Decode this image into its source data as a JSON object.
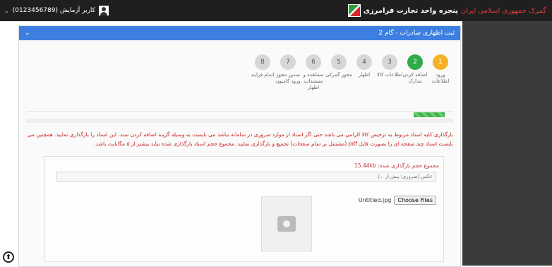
{
  "header": {
    "brand_title": "پنجره واحد تجارت فرامرزی",
    "brand_sub": "گمرک جمهوری اسلامی ایران",
    "user_label": "کاربر آزمایش (0123456789)",
    "caret": "⌄"
  },
  "panel": {
    "title": "ثبت اظهاری صادرات - گام 2",
    "collapse_icon": "⌄"
  },
  "steps": [
    {
      "num": "1",
      "label": "ورود اطلاعات",
      "state": "done"
    },
    {
      "num": "2",
      "label": "اضافه کردن مدارک",
      "state": "active"
    },
    {
      "num": "3",
      "label": "اطلاعات کالا",
      "state": "pending"
    },
    {
      "num": "4",
      "label": "اظهار",
      "state": "pending"
    },
    {
      "num": "5",
      "label": "مجوز گمرکی",
      "state": "pending"
    },
    {
      "num": "6",
      "label": "مشاهده و مستندات اظهار",
      "state": "pending"
    },
    {
      "num": "7",
      "label": "صدور مجوز ورود کامیون",
      "state": "pending"
    },
    {
      "num": "8",
      "label": "اتمام فرایند",
      "state": "pending"
    }
  ],
  "warning": "بارگذاری کلیه اسناد مربوط به ترخیص کالا الزامی می باشد حتی اگر اسناد از موارد ضروری در سامانه نباشد می بایست به وسیله گزینه اضافه کردن سند، این اسناد را بارگذاری نمایید. همچنین می بایست اسناد چند صفحه ای را بصورت فایل pdf (مشتمل بر تمام صفحات) تجمیع و بارگذاری نمایید. مجموع حجم اسناد بارگذاری شده نباید بیشتر از ۵ مگابایت باشد.",
  "upload": {
    "max_size_label": "مجموع حجم بارگذاری شده: 15.44kb",
    "desc_placeholder": "عکس (ضروری: بیش از ...)",
    "file_name": "Untitled.jpg",
    "choose_label": "Choose Files"
  },
  "icons": {
    "scroll_top": "⬆"
  },
  "colors": {
    "topbar": "#1f1f1f",
    "panel_header": "#3d7fe0",
    "step_done": "#f5b225",
    "step_active": "#2eab4b",
    "warning_text": "#c8201f"
  }
}
